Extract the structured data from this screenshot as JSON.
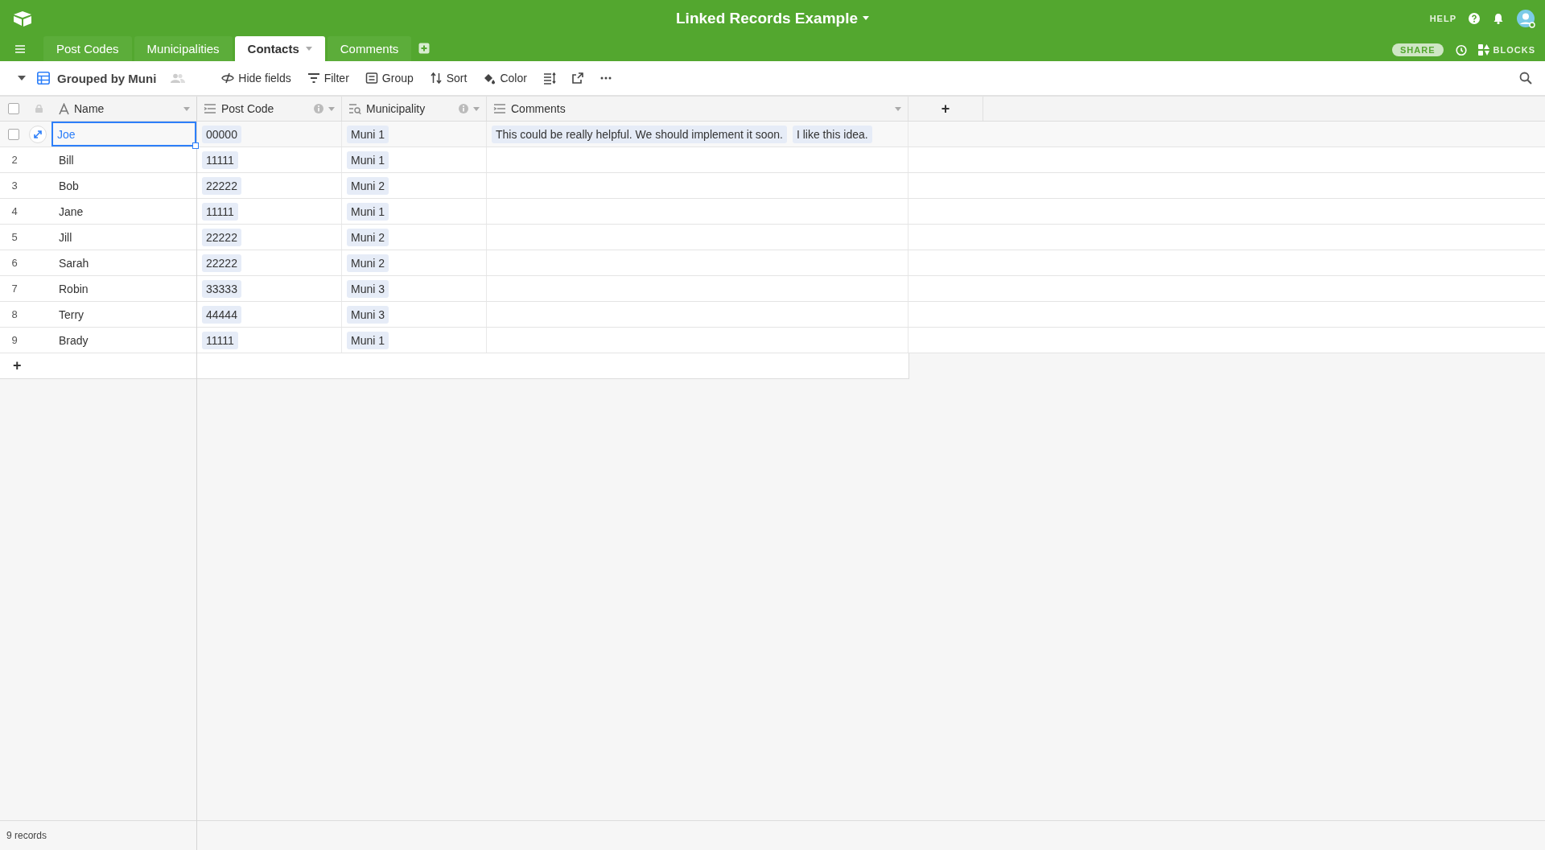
{
  "base": {
    "title": "Linked Records Example"
  },
  "top_links": {
    "help": "HELP",
    "share": "SHARE",
    "blocks": "BLOCKS"
  },
  "tabs": [
    {
      "label": "Post Codes",
      "selected": false
    },
    {
      "label": "Municipalities",
      "selected": false
    },
    {
      "label": "Contacts",
      "selected": true
    },
    {
      "label": "Comments",
      "selected": false
    }
  ],
  "view": {
    "name": "Grouped by Muni"
  },
  "toolbar": [
    {
      "kind": "hide",
      "label": "Hide fields"
    },
    {
      "kind": "filter",
      "label": "Filter"
    },
    {
      "kind": "group",
      "label": "Group"
    },
    {
      "kind": "sort",
      "label": "Sort"
    },
    {
      "kind": "color",
      "label": "Color"
    },
    {
      "kind": "height"
    },
    {
      "kind": "share"
    },
    {
      "kind": "more"
    }
  ],
  "columns": [
    {
      "kind": "text",
      "label": "Name"
    },
    {
      "kind": "link",
      "label": "Post Code"
    },
    {
      "kind": "lookup",
      "label": "Municipality"
    },
    {
      "kind": "link",
      "label": "Comments"
    }
  ],
  "rows": [
    {
      "active": true,
      "checked": false,
      "name": "Joe",
      "post_code": [
        "00000"
      ],
      "municipality": [
        "Muni 1"
      ],
      "comments": [
        "This could be really helpful. We should implement it soon.",
        "I like this idea."
      ]
    },
    {
      "active": false,
      "checked": false,
      "number": "2",
      "name": "Bill",
      "post_code": [
        "11111"
      ],
      "municipality": [
        "Muni 1"
      ]
    },
    {
      "active": false,
      "checked": false,
      "number": "3",
      "name": "Bob",
      "post_code": [
        "22222"
      ],
      "municipality": [
        "Muni 2"
      ]
    },
    {
      "active": false,
      "checked": false,
      "number": "4",
      "name": "Jane",
      "post_code": [
        "11111"
      ],
      "municipality": [
        "Muni 1"
      ]
    },
    {
      "active": false,
      "checked": false,
      "number": "5",
      "name": "Jill",
      "post_code": [
        "22222"
      ],
      "municipality": [
        "Muni 2"
      ]
    },
    {
      "active": false,
      "checked": false,
      "number": "6",
      "name": "Sarah",
      "post_code": [
        "22222"
      ],
      "municipality": [
        "Muni 2"
      ]
    },
    {
      "active": false,
      "checked": false,
      "number": "7",
      "name": "Robin",
      "post_code": [
        "33333"
      ],
      "municipality": [
        "Muni 3"
      ]
    },
    {
      "active": false,
      "checked": false,
      "number": "8",
      "name": "Terry",
      "post_code": [
        "44444"
      ],
      "municipality": [
        "Muni 3"
      ]
    },
    {
      "active": false,
      "checked": false,
      "number": "9",
      "name": "Brady",
      "post_code": [
        "11111"
      ],
      "municipality": [
        "Muni 1"
      ]
    }
  ],
  "select_all": {
    "checked": false
  },
  "add_row": "+",
  "add_column": "+",
  "status_bar": {
    "count": "9 records"
  }
}
